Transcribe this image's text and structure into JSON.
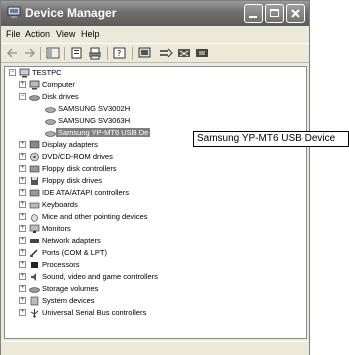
{
  "window": {
    "title": "Device Manager"
  },
  "menu": [
    "File",
    "Action",
    "View",
    "Help"
  ],
  "tree": {
    "root": "TESTPC",
    "items": [
      "Computer",
      "Disk drives",
      "SAMSUNG SV3002H",
      "SAMSUNG SV3063H",
      "Samsung YP-MT6 USB De",
      "Display adapters",
      "DVD/CD-ROM drives",
      "Floppy disk controllers",
      "Floppy disk drives",
      "IDE ATA/ATAPI controllers",
      "Keyboards",
      "Mice and other pointing devices",
      "Monitors",
      "Network adapters",
      "Ports (COM & LPT)",
      "Processors",
      "Sound, video and game controllers",
      "Storage volumes",
      "System devices",
      "Universal Serial Bus controllers"
    ]
  },
  "tooltip": "Samsung YP-MT6 USB Device"
}
